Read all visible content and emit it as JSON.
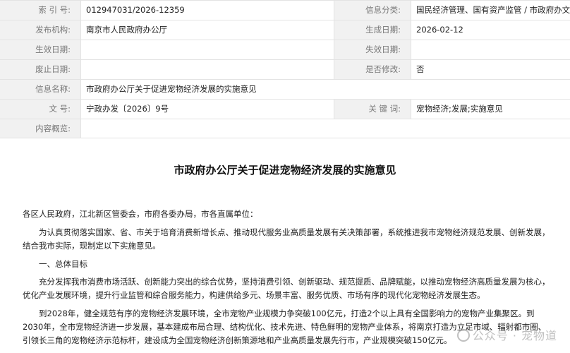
{
  "meta": {
    "index_label": "索 引 号:",
    "index_value": "012947031/2026-12359",
    "category_label": "信息分类:",
    "category_value": "国民经济管理、国有资产监管 / 市政府办文件 / 意见",
    "publisher_label": "发布机构:",
    "publisher_value": "南京市人民政府办公厅",
    "created_label": "生成日期:",
    "created_value": "2026-02-12",
    "effective_label": "生效日期:",
    "effective_value": "",
    "expiry_label": "失效日期:",
    "expiry_value": "",
    "abolish_label": "废止日期:",
    "abolish_value": "",
    "revised_label": "是否修改:",
    "revised_value": "否",
    "name_label": "信息名称:",
    "name_value": "市政府办公厅关于促进宠物经济发展的实施意见",
    "docno_label": "文        号:",
    "docno_value": "宁政办发〔2026〕9号",
    "keywords_label": "关 键 词:",
    "keywords_value": "宠物经济;发展;实施意见",
    "summary_label": "内容概览:",
    "summary_value": ""
  },
  "document": {
    "title": "市政府办公厅关于促进宠物经济发展的实施意见",
    "salutation": "各区人民政府，江北新区管委会，市府各委办局，市各直属单位：",
    "p1": "为认真贯彻落实国家、省、市关于培育消费新增长点、推动现代服务业高质量发展有关决策部署，系统推进我市宠物经济规范发展、创新发展，结合我市实际，现制定以下实施意见。",
    "h1": "一、总体目标",
    "p2": "充分发挥我市消费市场活跃、创新能力突出的综合优势，坚持消费引领、创新驱动、规范提质、品牌赋能，以推动宠物经济高质量发展为核心，优化产业发展环境，提升行业监管和综合服务能力，构建供给多元、场景丰富、服务优质、市场有序的现代化宠物经济发展生态。",
    "p3": "到2028年，健全规范有序的宠物经济发展环境，全市宠物产业规模力争突破100亿元，打造2个以上具有全国影响力的宠物产业集聚区。到2030年，全市宠物经济进一步发展，基本建成布局合理、结构优化、技术先进、特色鲜明的宠物产业体系，将南京打造为立足市域、辐射都市圈、引领长三角的宠物经济示范标杆，建设成为全国宠物经济创新策源地和产业高质量发展先行市，产业规模突破150亿元。"
  },
  "watermark": "公众号 · 宠物道"
}
